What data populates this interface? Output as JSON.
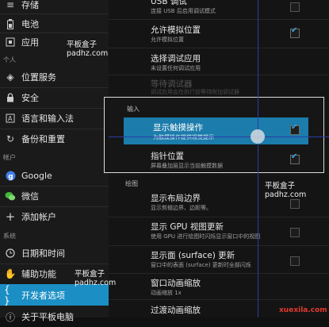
{
  "sidebar": {
    "items": [
      {
        "label": "存储",
        "icon": "storage-icon"
      },
      {
        "label": "电池",
        "icon": "battery-icon"
      },
      {
        "label": "应用",
        "icon": "apps-icon"
      },
      {
        "label": "位置服务",
        "icon": "location-icon"
      },
      {
        "label": "安全",
        "icon": "lock-icon"
      },
      {
        "label": "语言和输入法",
        "icon": "language-icon"
      },
      {
        "label": "备份和重置",
        "icon": "backup-icon"
      },
      {
        "label": "Google",
        "icon": "google-icon"
      },
      {
        "label": "微信",
        "icon": "wechat-icon"
      },
      {
        "label": "添加帐户",
        "icon": "add-icon"
      },
      {
        "label": "日期和时间",
        "icon": "clock-icon"
      },
      {
        "label": "辅助功能",
        "icon": "hand-icon"
      },
      {
        "label": "开发者选项",
        "icon": "developer-icon"
      },
      {
        "label": "关于平板电脑",
        "icon": "info-icon"
      }
    ],
    "headers": {
      "personal": "个人",
      "accounts": "帐户",
      "system": "系统"
    }
  },
  "main": {
    "usb_debug": {
      "title": "USB 调试",
      "subtitle": "连接 USB 后启用调试模式"
    },
    "mock_location": {
      "title": "允许模拟位置",
      "subtitle": "允许模拟位置"
    },
    "select_debug_app": {
      "title": "选择调试应用",
      "subtitle": "未设置任何调试应用"
    },
    "wait_debugger": {
      "title": "等待调试器",
      "subtitle": "调试应用会在执行前等待附加调试器"
    },
    "input_header": "输入",
    "show_touches": {
      "title": "显示触摸操作",
      "subtitle": "为触摸操作提供视觉提示"
    },
    "pointer_location": {
      "title": "指针位置",
      "subtitle": "屏幕叠加层显示当前触摸数据"
    },
    "drawing_header": "绘图",
    "layout_bounds": {
      "title": "显示布局边界",
      "subtitle": "显示剪辑边界、边距等。"
    },
    "gpu_updates": {
      "title": "显示 GPU 视图更新",
      "subtitle": "使用 GPU 进行绘图时闪烁显示窗口中的视图"
    },
    "surface_updates": {
      "title": "显示面 (surface) 更新",
      "subtitle": "窗口中的表面 (surface) 更新时全部闪烁"
    },
    "window_anim": {
      "title": "窗口动画缩放",
      "subtitle": "动画缩放 1x"
    },
    "transition_anim": {
      "title": "过渡动画缩放"
    }
  },
  "watermarks": {
    "brand": "平板盒子",
    "domain": "padhz.com",
    "corner": "xuexila.com"
  }
}
